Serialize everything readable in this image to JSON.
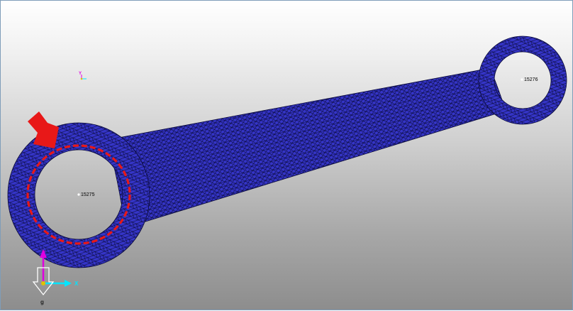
{
  "viewport": {
    "mesh_color": "#3535c8",
    "mesh_line_color": "#0a0a3a",
    "highlight_color": "#e81818"
  },
  "nodes": {
    "small_end": "15275",
    "big_end": "15276"
  },
  "triad": {
    "x_label": "X",
    "y_label": "Y",
    "gravity_label": "g",
    "x_color": "#00e5ff",
    "y_color": "#e000e0"
  },
  "mini_triad": {
    "y_label": "Y"
  },
  "icons": [
    "load-arrow-icon",
    "coordinate-triad-icon",
    "gravity-arrow-icon",
    "highlight-circle-icon"
  ]
}
